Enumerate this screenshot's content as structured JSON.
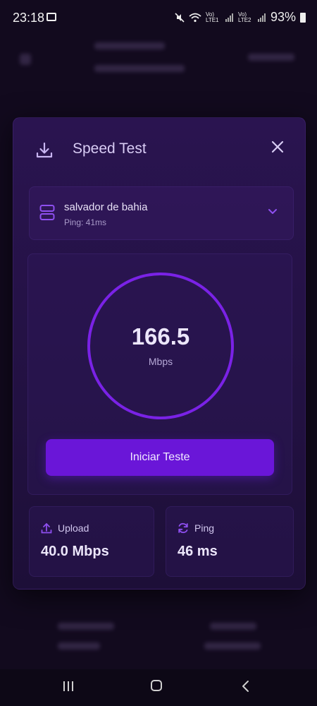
{
  "status_bar": {
    "time": "23:18",
    "battery": "93%",
    "net1": "Vo) LTE1",
    "net2": "Vo) LTE2"
  },
  "modal": {
    "title": "Speed Test",
    "icon": "download-icon",
    "close_icon": "close-icon"
  },
  "server": {
    "name": "salvador de bahia",
    "ping": "Ping: 41ms",
    "icon": "server-icon",
    "chevron": "chevron-down-icon"
  },
  "gauge": {
    "value": "166.5",
    "unit": "Mbps"
  },
  "start_button": {
    "label": "Iniciar Teste"
  },
  "stats": {
    "upload": {
      "label": "Upload",
      "value": "40.0 Mbps",
      "icon": "upload-icon"
    },
    "ping": {
      "label": "Ping",
      "value": "46 ms",
      "icon": "refresh-icon"
    }
  },
  "colors": {
    "accent": "#6a16d8",
    "ring": "#7a22e6",
    "icon": "#8e4ff0"
  }
}
